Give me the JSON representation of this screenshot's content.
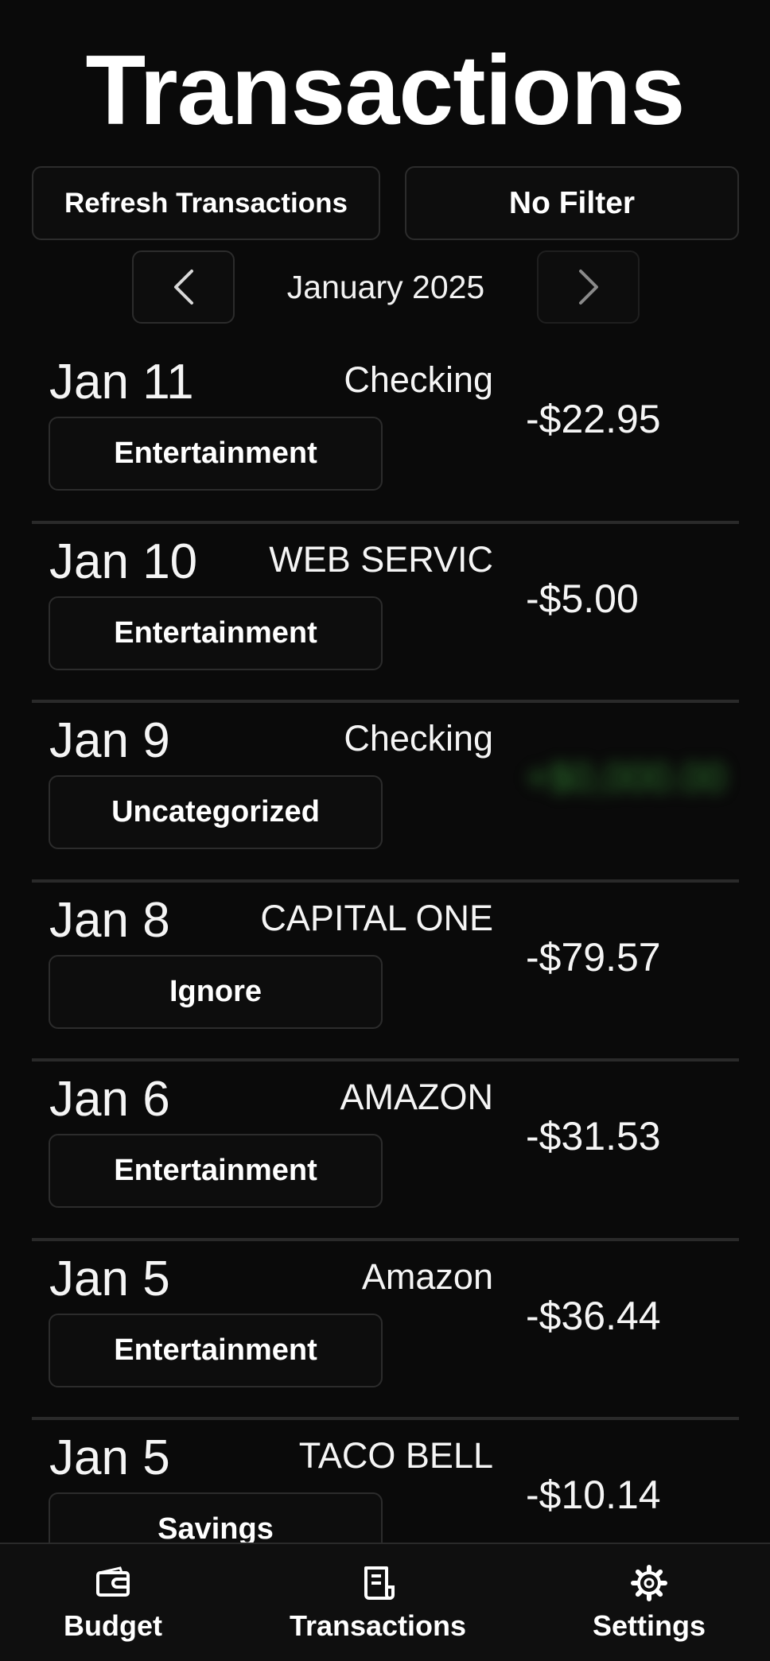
{
  "header": {
    "title": "Transactions"
  },
  "toolbar": {
    "refresh_label": "Refresh Transactions",
    "filter_label": "No Filter"
  },
  "month_nav": {
    "prev_icon": "chevron-left-icon",
    "label": "January 2025",
    "next_icon": "chevron-right-icon"
  },
  "transactions": [
    {
      "date": "Jan 11",
      "account": "Checking",
      "amount": "-$22.95",
      "category": "Entertainment"
    },
    {
      "date": "Jan 10",
      "account": "WEB SERVIC",
      "amount": "-$5.00",
      "category": "Entertainment"
    },
    {
      "date": "Jan 9",
      "account": "Checking",
      "amount": "",
      "category": "Uncategorized"
    },
    {
      "date": "Jan 8",
      "account": "CAPITAL ONE",
      "amount": "-$79.57",
      "category": "Ignore"
    },
    {
      "date": "Jan 6",
      "account": "AMAZON",
      "amount": "-$31.53",
      "category": "Entertainment"
    },
    {
      "date": "Jan 5",
      "account": "Amazon",
      "amount": "-$36.44",
      "category": "Entertainment"
    },
    {
      "date": "Jan 5",
      "account": "TACO BELL",
      "amount": "-$10.14",
      "category": "Savings"
    }
  ],
  "bottom_nav": {
    "items": [
      {
        "label": "Budget",
        "icon": "wallet-icon"
      },
      {
        "label": "Transactions",
        "icon": "receipt-icon"
      },
      {
        "label": "Settings",
        "icon": "gear-icon"
      }
    ]
  },
  "colors": {
    "background": "#0a0a0a",
    "button_border": "#2c2c2c",
    "divider": "#2a2a2a",
    "text": "#f5f5f5"
  }
}
